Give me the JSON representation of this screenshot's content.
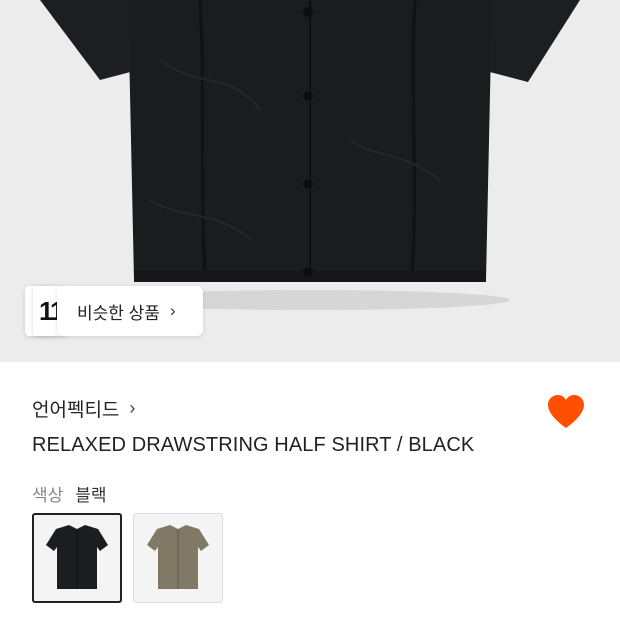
{
  "similar": {
    "thumb_text": "11",
    "label": "비슷한 상품",
    "chevron": "›"
  },
  "product": {
    "brand": "언어펙티드",
    "brand_chevron": "›",
    "title": "RELAXED DRAWSTRING HALF SHIRT / BLACK",
    "color_label": "색상",
    "color_value": "블랙",
    "liked": true
  },
  "swatches": [
    {
      "name": "black",
      "color": "#1c1d20",
      "selected": true
    },
    {
      "name": "khaki",
      "color": "#807966",
      "selected": false
    }
  ],
  "colors": {
    "heart": "#ff4f00",
    "hero_bg": "#ececec",
    "shirt": "#1b1c1f"
  }
}
